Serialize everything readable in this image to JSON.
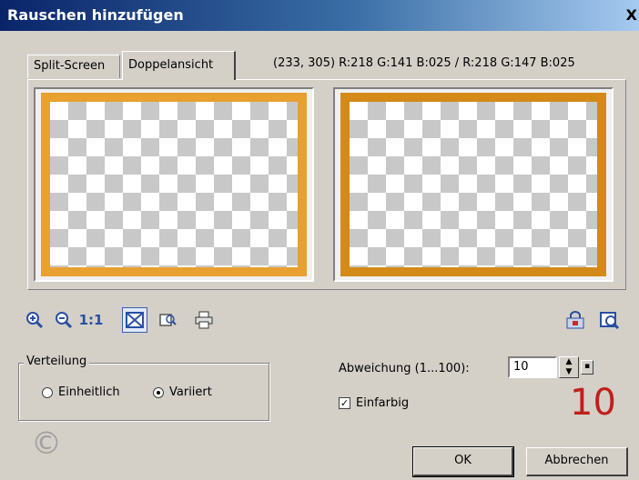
{
  "window": {
    "title": "Rauschen hinzufügen",
    "close_label": "X"
  },
  "tabs": [
    {
      "label": "Split-Screen",
      "active": false
    },
    {
      "label": "Doppelansicht",
      "active": true
    }
  ],
  "pixel_readout": "(233, 305) R:218 G:141 B:025 / R:218 G:147 B:025",
  "previews": {
    "frame_color_original": "#e8a030",
    "frame_color_result": "#d48a18"
  },
  "toolbar": {
    "icons": [
      "zoom-in-icon",
      "zoom-out-icon",
      "actual-size-icon",
      "fit-view-icon",
      "navigator-icon",
      "print-icon",
      "lock-icon",
      "preview-toggle-icon"
    ],
    "actual_size_label": "1:1"
  },
  "distribution": {
    "label": "Verteilung",
    "options": [
      {
        "label": "Einheitlich",
        "selected": false
      },
      {
        "label": "Variiert",
        "selected": true
      }
    ]
  },
  "deviation": {
    "label": "Abweichung (1...100):",
    "value": "10"
  },
  "monochrome": {
    "label": "Einfarbig",
    "checked": true
  },
  "annotation": {
    "value": "10",
    "color": "#c0201c"
  },
  "buttons": {
    "ok": "OK",
    "cancel": "Abbrechen"
  },
  "watermark": {
    "symbol": "©"
  }
}
